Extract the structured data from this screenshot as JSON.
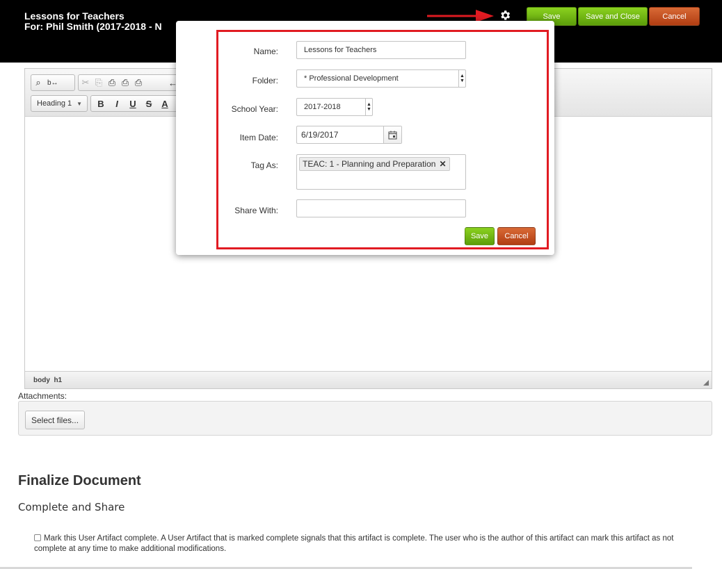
{
  "header": {
    "title": "Lessons for Teachers",
    "subtitle": "For: Phil Smith (2017-2018 - N",
    "save_label": "Save",
    "save_close_label": "Save and Close",
    "cancel_label": "Cancel"
  },
  "editor": {
    "heading_select": "Heading 1",
    "toolbar_row1": [
      "find-icon",
      "replace-icon",
      "cut-icon",
      "copy-icon",
      "paste-icon",
      "paste-text-icon",
      "paste-word-icon",
      "undo-icon"
    ],
    "toolbar_row2": [
      "B",
      "I",
      "U",
      "S",
      "A"
    ],
    "status_path": "body  h1"
  },
  "attachments": {
    "label": "Attachments:",
    "select_files_label": "Select files..."
  },
  "finalize": {
    "heading": "Finalize Document",
    "subheading": "Complete and Share",
    "checkbox_text": "Mark this User Artifact complete. A User Artifact that is marked complete signals that this artifact is complete. The user who is the author of this artifact can mark this artifact as not complete at any time to make additional modifications.",
    "checked": false
  },
  "modal": {
    "name_label": "Name:",
    "name_value": "Lessons for Teachers",
    "folder_label": "Folder:",
    "folder_value": "* Professional Development",
    "school_year_label": "School Year:",
    "school_year_value": "2017-2018",
    "item_date_label": "Item Date:",
    "item_date_value": "6/19/2017",
    "tag_label": "Tag As:",
    "tags": [
      "TEAC: 1 - Planning and Preparation"
    ],
    "share_label": "Share With:",
    "share_value": "",
    "save_label": "Save",
    "cancel_label": "Cancel"
  },
  "colors": {
    "header_bg": "#000000",
    "save_green": "#6cb014",
    "cancel_red": "#c24a1c",
    "highlight_red": "#e11b22",
    "annotation_arrow": "#e11b22"
  }
}
